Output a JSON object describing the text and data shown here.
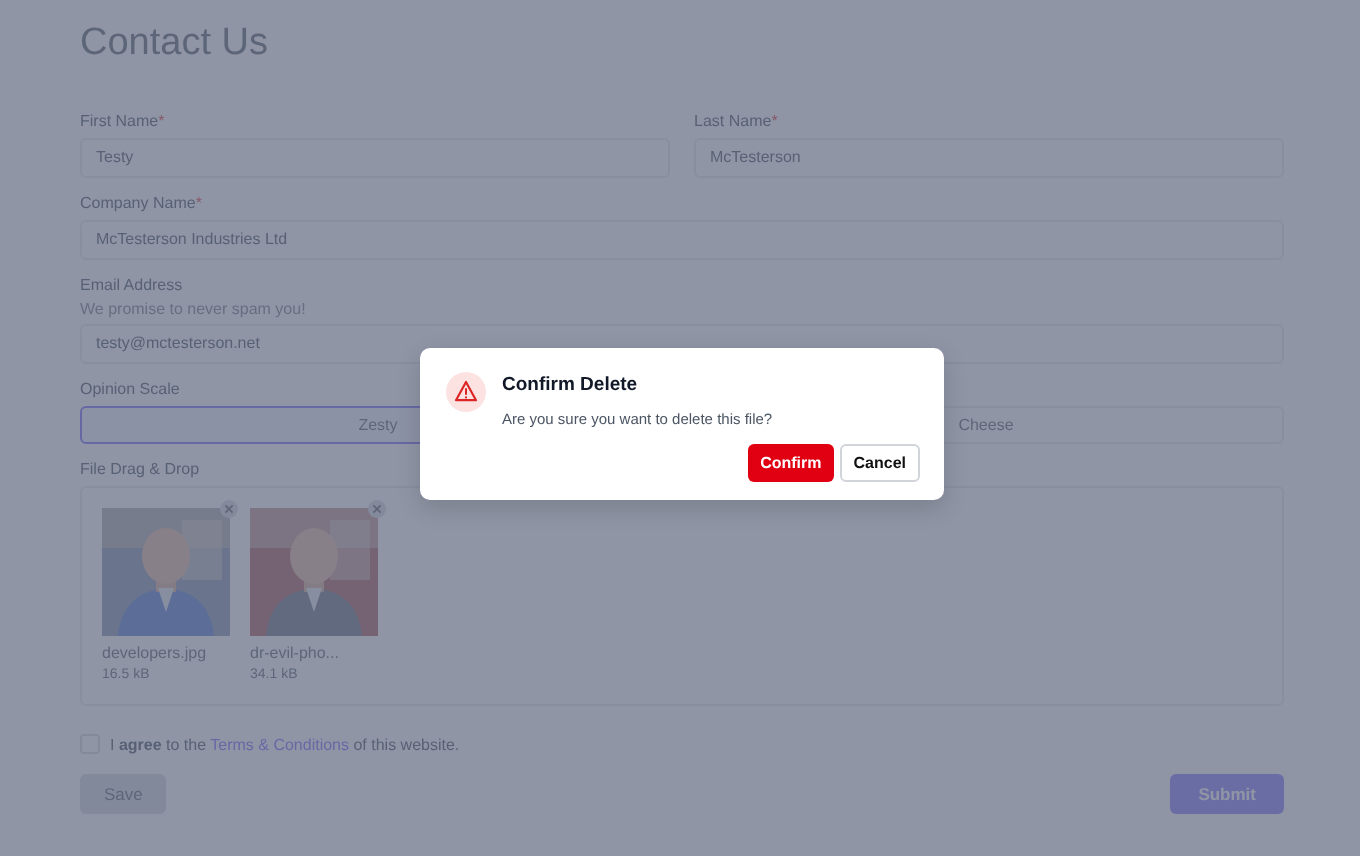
{
  "title": "Contact Us",
  "name_fields": [
    {
      "label": "First Name",
      "required_mark": "*",
      "value": "Testy"
    },
    {
      "label": "Last Name",
      "required_mark": "*",
      "value": "McTesterson"
    }
  ],
  "company": {
    "label": "Company Name",
    "required_mark": "*",
    "value": "McTesterson Industries Ltd"
  },
  "email": {
    "label": "Email Address",
    "help": "We promise to never spam you!",
    "value": "testy@mctesterson.net"
  },
  "opinion": {
    "label": "Opinion Scale",
    "options": [
      {
        "label": "Zesty",
        "selected": true
      },
      {
        "label": "Cheese",
        "selected": false
      }
    ]
  },
  "files": {
    "label": "File Drag & Drop",
    "items": [
      {
        "name": "developers.jpg",
        "size": "16.5 kB",
        "kind": "picture"
      },
      {
        "name": "dr-evil-pho...",
        "size": "34.1 kB",
        "kind": "picture"
      }
    ]
  },
  "agree": {
    "checked": false,
    "before": "I **agree** to the",
    "link": "Terms & Conditions",
    "after": "of this website."
  },
  "buttons": {
    "save": "Save",
    "submit": "Submit"
  },
  "dialog": {
    "title": "Confirm Delete",
    "message": "Are you sure you want to delete this file?",
    "confirm": "Confirm",
    "cancel": "Cancel"
  }
}
